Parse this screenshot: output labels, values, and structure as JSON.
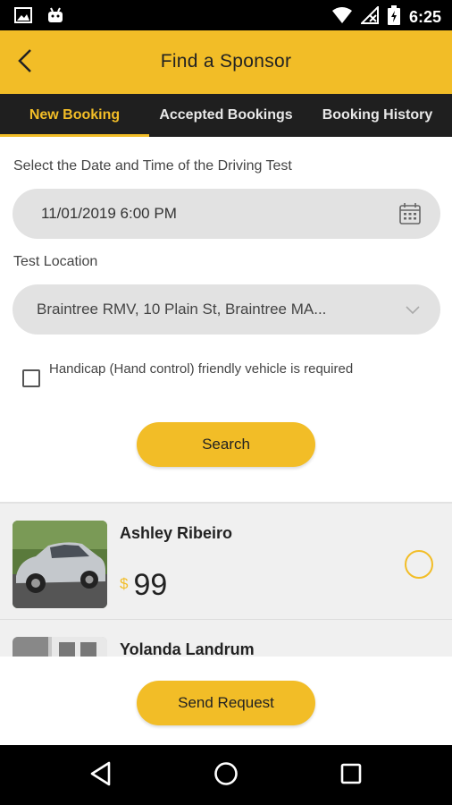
{
  "status_bar": {
    "time": "6:25",
    "icons": [
      "image-icon",
      "android-icon",
      "wifi-icon",
      "no-signal-icon",
      "battery-charging-icon"
    ]
  },
  "app_bar": {
    "title": "Find a Sponsor",
    "back_icon": "chevron-left-icon"
  },
  "tabs": [
    {
      "label": "New Booking",
      "active": true
    },
    {
      "label": "Accepted Bookings",
      "active": false
    },
    {
      "label": "Booking History",
      "active": false
    }
  ],
  "form": {
    "date_label": "Select the Date and Time of the Driving Test",
    "date_value": "11/01/2019 6:00 PM",
    "location_label": "Test Location",
    "location_value": "Braintree RMV, 10 Plain St, Braintree MA...",
    "handicap_label": "Handicap (Hand control) friendly vehicle is required",
    "handicap_checked": false,
    "search_label": "Search"
  },
  "sponsors": [
    {
      "name": "Ashley Ribeiro",
      "currency": "$",
      "price": "99",
      "selected": false
    },
    {
      "name": "Yolanda Landrum"
    }
  ],
  "footer": {
    "send_label": "Send Request"
  },
  "colors": {
    "accent": "#f2bd27",
    "tab_bar": "#1f1f1f",
    "field_bg": "#e2e2e2"
  }
}
